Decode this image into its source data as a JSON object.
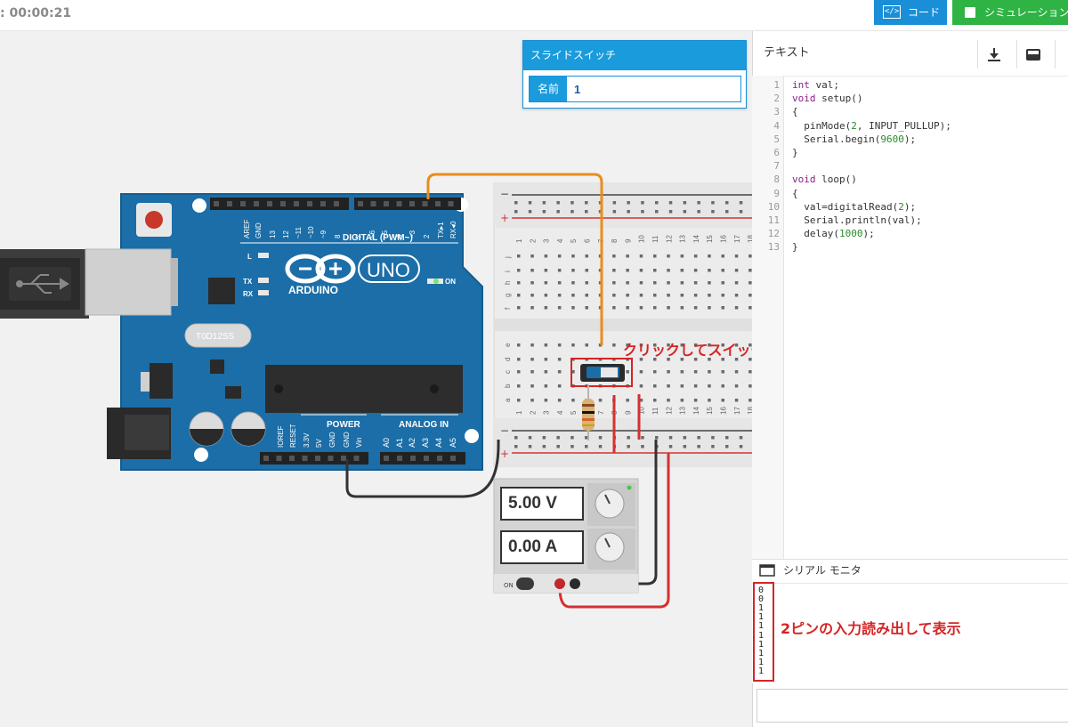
{
  "toolbar": {
    "timer": ": 00:00:21",
    "code_button": "コード",
    "simulation_button": "シミュレーション",
    "code_icon": "code-icon",
    "simulation_icon": "stop-square-icon"
  },
  "switch_panel": {
    "title": "スライドスイッチ",
    "name_label": "名前",
    "name_value": "1"
  },
  "annotations": {
    "switch_hint": "クリックしてスイッチを切り替える",
    "serial_hint": "2ピンの入力読み出して表示"
  },
  "arduino": {
    "board_logo": "ARDUINO",
    "model": "UNO",
    "digital_header": "DIGITAL (PWM~)",
    "digital_pins": [
      "AREF",
      "GND",
      "13",
      "12",
      "~11",
      "~10",
      "~9",
      "8",
      "7",
      "~6",
      "~5",
      "4",
      "~3",
      "2",
      "TX▸1",
      "RX◂0"
    ],
    "power_header": "POWER",
    "analog_header": "ANALOG IN",
    "power_pins": [
      "IOREF",
      "RESET",
      "3.3V",
      "5V",
      "GND",
      "GND",
      "Vin"
    ],
    "analog_pins": [
      "A0",
      "A1",
      "A2",
      "A3",
      "A4",
      "A5"
    ],
    "led_labels": [
      "L",
      "TX",
      "RX"
    ],
    "on_label": "ON",
    "crystal_label": "T0D12SS"
  },
  "breadboard": {
    "row_letters_top": [
      "j",
      "i",
      "h",
      "g",
      "f"
    ],
    "row_letters_bottom": [
      "e",
      "d",
      "c",
      "b",
      "a"
    ],
    "columns": [
      "1",
      "2",
      "3",
      "4",
      "5",
      "6",
      "7",
      "8",
      "9",
      "10",
      "11",
      "12",
      "13",
      "14",
      "15",
      "16",
      "17",
      "18"
    ],
    "rail_minus": "−",
    "rail_plus": "+"
  },
  "power_supply": {
    "voltage": "5.00 V",
    "current": "0.00 A",
    "on_label": "ON"
  },
  "code_panel": {
    "title": "テキスト",
    "tools": [
      "download-icon",
      "library-icon"
    ],
    "lines": [
      [
        {
          "t": "int",
          "c": "kw"
        },
        {
          "t": " val;"
        }
      ],
      [
        {
          "t": "void",
          "c": "kw"
        },
        {
          "t": " setup()"
        }
      ],
      [
        {
          "t": "{"
        }
      ],
      [
        {
          "t": "  pinMode("
        },
        {
          "t": "2",
          "c": "num"
        },
        {
          "t": ", INPUT_PULLUP);"
        }
      ],
      [
        {
          "t": "  Serial.begin("
        },
        {
          "t": "9600",
          "c": "num"
        },
        {
          "t": ");"
        }
      ],
      [
        {
          "t": "}"
        }
      ],
      [
        {
          "t": ""
        }
      ],
      [
        {
          "t": "void",
          "c": "kw"
        },
        {
          "t": " loop()"
        }
      ],
      [
        {
          "t": "{"
        }
      ],
      [
        {
          "t": "  val=digitalRead("
        },
        {
          "t": "2",
          "c": "num"
        },
        {
          "t": ");"
        }
      ],
      [
        {
          "t": "  Serial.println(val);"
        }
      ],
      [
        {
          "t": "  delay("
        },
        {
          "t": "1000",
          "c": "num"
        },
        {
          "t": ");"
        }
      ],
      [
        {
          "t": "}"
        }
      ]
    ]
  },
  "serial_monitor": {
    "title": "シリアル モニタ",
    "icon": "serial-monitor-icon",
    "output": [
      "0",
      "0",
      "1",
      "1",
      "1",
      "1",
      "1",
      "1",
      "1",
      "1"
    ]
  }
}
